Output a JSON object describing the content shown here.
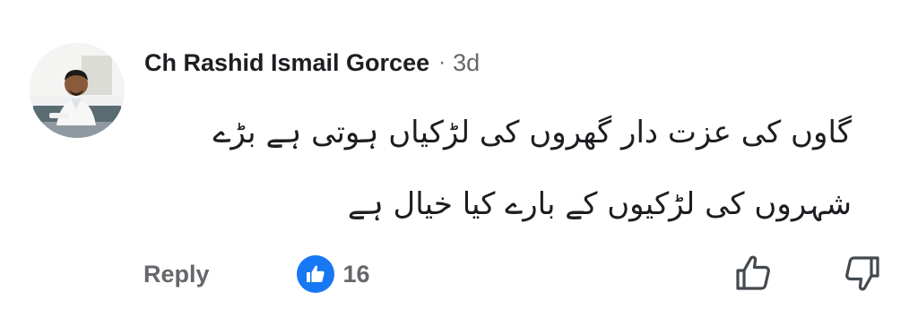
{
  "comment": {
    "author": "Ch Rashid Ismail Gorcee",
    "separator": "·",
    "timestamp": "3d",
    "text_lines": [
      "گاوں کی عزت دار گھروں کی لڑکیاں ہوتی ہے     بڑے",
      "شہروں کی لڑکیوں کے بارے کیا خیال  ہے"
    ],
    "reply_label": "Reply",
    "reaction": {
      "icon": "thumbs-up-icon",
      "count": "16",
      "color": "#1877f2"
    },
    "upvote_icon": "thumbs-up-outline-icon",
    "downvote_icon": "thumbs-down-outline-icon"
  },
  "colors": {
    "name": "#1c1e21",
    "secondary": "#65676b",
    "like_blue": "#1877f2"
  }
}
